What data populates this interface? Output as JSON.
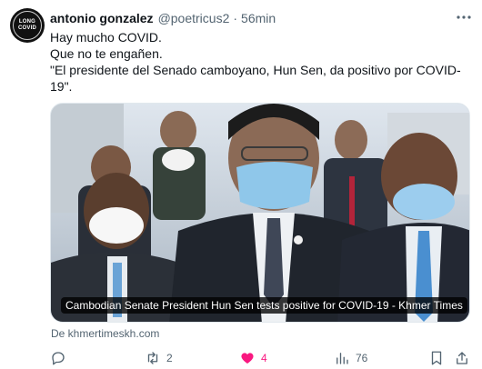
{
  "author": {
    "name": "antonio gonzalez",
    "handle": "@poetricus2",
    "separator": "·",
    "time": "56min",
    "avatar_text_line1": "LONG",
    "avatar_text_line2": "COVID"
  },
  "tweet": {
    "line1": "Hay mucho COVID.",
    "line2": "Que no te engañen.",
    "line3": "\"El presidente del Senado camboyano, Hun Sen, da positivo por COVID-19\"."
  },
  "card": {
    "caption": "Cambodian Senate President Hun Sen tests positive for COVID-19 - Khmer Times",
    "source": "De khmertimeskh.com"
  },
  "actions": {
    "replies": "",
    "reposts": "2",
    "likes": "4",
    "views": "76"
  },
  "colors": {
    "text": "#0f1419",
    "secondary": "#536471",
    "like": "#f91880",
    "border": "#e1e8ed"
  },
  "icons": [
    "more-icon",
    "reply-icon",
    "repost-icon",
    "like-icon",
    "views-icon",
    "bookmark-icon",
    "share-icon"
  ]
}
